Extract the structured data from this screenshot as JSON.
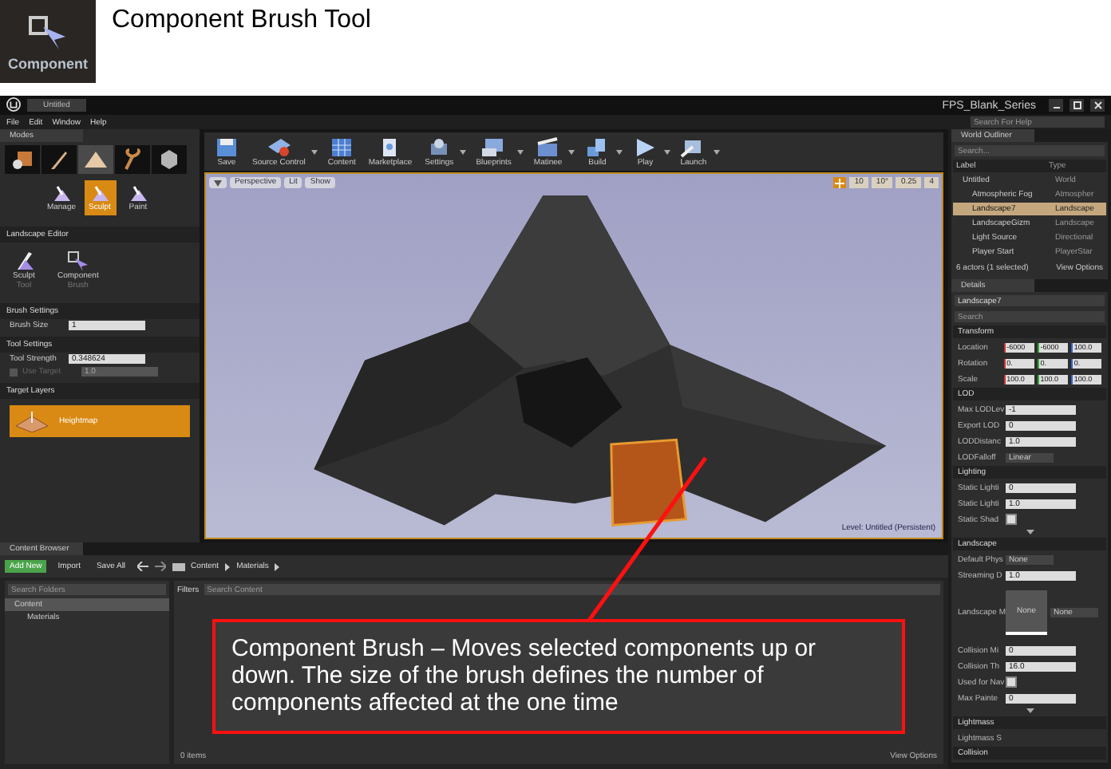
{
  "header": {
    "icon_label": "Component",
    "title": "Component Brush Tool"
  },
  "title_bar": {
    "tab": "Untitled",
    "project": "FPS_Blank_Series"
  },
  "menu": [
    "File",
    "Edit",
    "Window",
    "Help"
  ],
  "help_search": {
    "placeholder": "Search For Help"
  },
  "modes": {
    "title": "Modes",
    "mode_tabs": [
      {
        "kind": "place",
        "selected": false
      },
      {
        "kind": "paint",
        "selected": false
      },
      {
        "kind": "landscape",
        "selected": true
      },
      {
        "kind": "foliage",
        "selected": false
      },
      {
        "kind": "geometry",
        "selected": false
      }
    ],
    "landscape_modes": [
      {
        "label": "Manage",
        "selected": false
      },
      {
        "label": "Sculpt",
        "selected": true
      },
      {
        "label": "Paint",
        "selected": false
      }
    ],
    "editor_title": "Landscape Editor",
    "tools": [
      {
        "kind": "sculpt",
        "label": "Sculpt",
        "sublabel": "Tool"
      },
      {
        "kind": "component",
        "label": "Component",
        "sublabel": "Brush"
      }
    ],
    "sections": [
      {
        "title": "Brush Settings",
        "rows": [
          {
            "kind": "number",
            "label": "Brush Size",
            "value": "1"
          }
        ]
      },
      {
        "title": "Tool Settings",
        "rows": [
          {
            "kind": "number",
            "label": "Tool Strength",
            "value": "0.348624"
          },
          {
            "kind": "checked_number",
            "label": "Use Target",
            "value": "1.0",
            "checked": false
          }
        ]
      }
    ],
    "target_layers": {
      "title": "Target Layers",
      "layers": [
        {
          "label": "Heightmap",
          "selected": true
        }
      ]
    }
  },
  "toolbar": [
    {
      "kind": "save",
      "label": "Save",
      "dropdown": false
    },
    {
      "kind": "source_control",
      "label": "Source Control",
      "dropdown": true
    },
    {
      "kind": "content",
      "label": "Content",
      "dropdown": false
    },
    {
      "kind": "marketplace",
      "label": "Marketplace",
      "dropdown": false
    },
    {
      "kind": "settings",
      "label": "Settings",
      "dropdown": true
    },
    {
      "kind": "blueprints",
      "label": "Blueprints",
      "dropdown": true
    },
    {
      "kind": "matinee",
      "label": "Matinee",
      "dropdown": true
    },
    {
      "kind": "build",
      "label": "Build",
      "dropdown": true
    },
    {
      "kind": "play",
      "label": "Play",
      "dropdown": true
    },
    {
      "kind": "launch",
      "label": "Launch",
      "dropdown": true
    }
  ],
  "viewport": {
    "buttons": [
      "Perspective",
      "Lit",
      "Show"
    ],
    "snap_values": [
      "10",
      "10°",
      "0.25",
      "4"
    ],
    "level": "Level:  Untitled (Persistent)"
  },
  "world_outliner": {
    "title": "World Outliner",
    "search": {
      "placeholder": "Search..."
    },
    "columns": [
      "Label",
      "Type"
    ],
    "rows": [
      {
        "label": "Untitled",
        "type": "World",
        "selected": false,
        "children": [
          {
            "label": "Atmospheric Fog",
            "type": "Atmospher",
            "selected": false
          },
          {
            "label": "Landscape7",
            "type": "Landscape",
            "selected": true
          },
          {
            "label": "LandscapeGizm",
            "type": "Landscape",
            "selected": false
          },
          {
            "label": "Light Source",
            "type": "Directional",
            "selected": false
          },
          {
            "label": "Player Start",
            "type": "PlayerStar",
            "selected": false
          }
        ]
      }
    ],
    "summary": "6 actors (1 selected)",
    "view_options": "View Options"
  },
  "details": {
    "title": "Details",
    "name": "Landscape7",
    "search": {
      "placeholder": "Search"
    },
    "sections": [
      {
        "title": "Transform",
        "more": false,
        "rows": [
          {
            "kind": "vector",
            "label": "Location",
            "values": [
              "-6000",
              "-6000",
              "100.0"
            ]
          },
          {
            "kind": "vector",
            "label": "Rotation",
            "values": [
              "0.",
              "0.",
              "0."
            ]
          },
          {
            "kind": "vector",
            "label": "Scale",
            "values": [
              "100.0",
              "100.0",
              "100.0"
            ]
          }
        ]
      },
      {
        "title": "LOD",
        "more": false,
        "rows": [
          {
            "kind": "number",
            "label": "Max LODLev",
            "value": "-1"
          },
          {
            "kind": "number",
            "label": "Export LOD",
            "value": "0"
          },
          {
            "kind": "number",
            "label": "LODDistanc",
            "value": "1.0"
          },
          {
            "kind": "dropdown",
            "label": "LODFalloff",
            "value": "Linear"
          }
        ]
      },
      {
        "title": "Lighting",
        "more": true,
        "rows": [
          {
            "kind": "number",
            "label": "Static Lighti",
            "value": "0"
          },
          {
            "kind": "number",
            "label": "Static Lighti",
            "value": "1.0"
          },
          {
            "kind": "checkbox",
            "label": "Static Shad",
            "checked": true
          }
        ]
      },
      {
        "title": "Landscape",
        "more": true,
        "rows": [
          {
            "kind": "asset",
            "label": "Default Phys",
            "value": "None"
          },
          {
            "kind": "number",
            "label": "Streaming D",
            "value": "1.0"
          },
          {
            "kind": "material",
            "label": "Landscape M",
            "thumbnail": "None",
            "value": "None"
          },
          {
            "kind": "number",
            "label": "Collision Mi",
            "value": "0"
          },
          {
            "kind": "number",
            "label": "Collision Th",
            "value": "16.0"
          },
          {
            "kind": "checkbox",
            "label": "Used for Nav",
            "checked": true
          },
          {
            "kind": "number",
            "label": "Max Painte",
            "value": "0"
          }
        ]
      },
      {
        "title": "Lightmass",
        "more": false,
        "rows": [
          {
            "kind": "group",
            "label": "Lightmass S"
          }
        ]
      },
      {
        "title": "Collision",
        "more": false
      }
    ]
  },
  "content_browser": {
    "tab": "Content Browser",
    "buttons": [
      {
        "kind": "add",
        "label": "Add New"
      },
      {
        "kind": "import",
        "label": "Import"
      },
      {
        "kind": "save",
        "label": "Save All"
      }
    ],
    "path": [
      "Content",
      "Materials"
    ],
    "folder_search": {
      "placeholder": "Search Folders"
    },
    "filters": "Filters",
    "content_search": {
      "placeholder": "Search Content"
    },
    "folders": [
      {
        "label": "Content",
        "selected": true,
        "children": [
          {
            "label": "Materials",
            "selected": false
          }
        ]
      }
    ],
    "item_count": "0 items",
    "view_options": "View Options"
  },
  "callout": {
    "text": "Component Brush – Moves selected components up or down. The size of the brush defines the number of components affected at the one time"
  }
}
